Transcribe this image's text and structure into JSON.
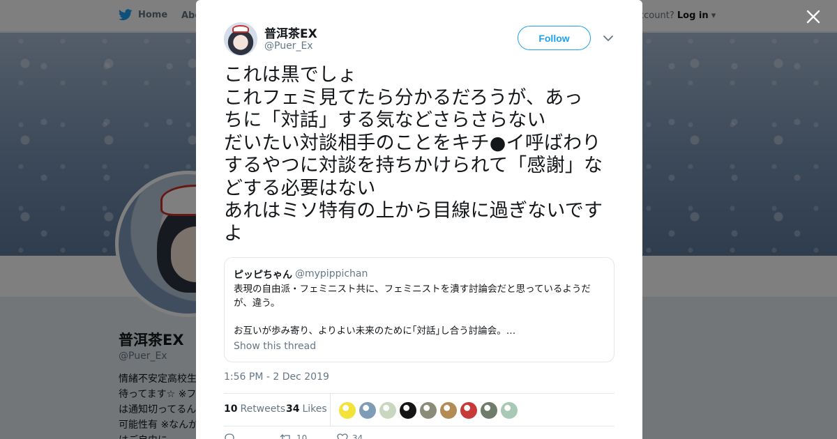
{
  "nav": {
    "home_label": "Home",
    "about_label": "Abo",
    "account_prompt": "ccount?",
    "login_label": "Log in"
  },
  "profile": {
    "name": "普洱茶EX",
    "handle": "@Puer_Ex",
    "bio_lines": [
      "情緒不安定高校生",
      "待ってます☆ ※フ",
      "は通知切ってるん",
      "可能性有 ※なんか",
      "はご自由に"
    ]
  },
  "tweet": {
    "author_name": "普洱茶EX",
    "author_handle": "@Puer_Ex",
    "follow_label": "Follow",
    "text_lines": [
      "これは黒でしょ",
      "これフェミ見てたら分かるだろうが、あっ",
      "ちに「対話」する気などさらさらない",
      "だいたい対談相手のことをキチ●イ呼ばわり",
      "するやつに対談を持ちかけられて「感謝」な",
      "どする必要はない",
      "あれはミソ特有の上から目線に過ぎないです",
      "よ"
    ],
    "quote": {
      "name": "ピッピちゃん",
      "handle": "@mypippichan",
      "text_lines": [
        "表現の自由派・フェミニスト共に、フェミニストを潰す討論会だと思っているようだ",
        "が、違う。",
        "",
        "お互いが歩み寄り、よりよい未来のために｢対話｣し合う討論会。…"
      ],
      "show_thread_label": "Show this thread"
    },
    "timestamp": "1:56 PM - 2 Dec 2019",
    "retweets_count": "10",
    "retweets_label": "Retweets",
    "likes_count": "34",
    "likes_label": "Likes",
    "action_retweet_count": "10",
    "action_like_count": "34",
    "liker_colors": [
      "#f2e23a",
      "#7f9cb6",
      "#c9d7c0",
      "#151515",
      "#8b8b7a",
      "#b38c55",
      "#c83a3a",
      "#6f7c6a",
      "#a8c9b5"
    ]
  },
  "colors": {
    "accent": "#1da1f2",
    "text": "#14171a",
    "secondary": "#657786"
  }
}
